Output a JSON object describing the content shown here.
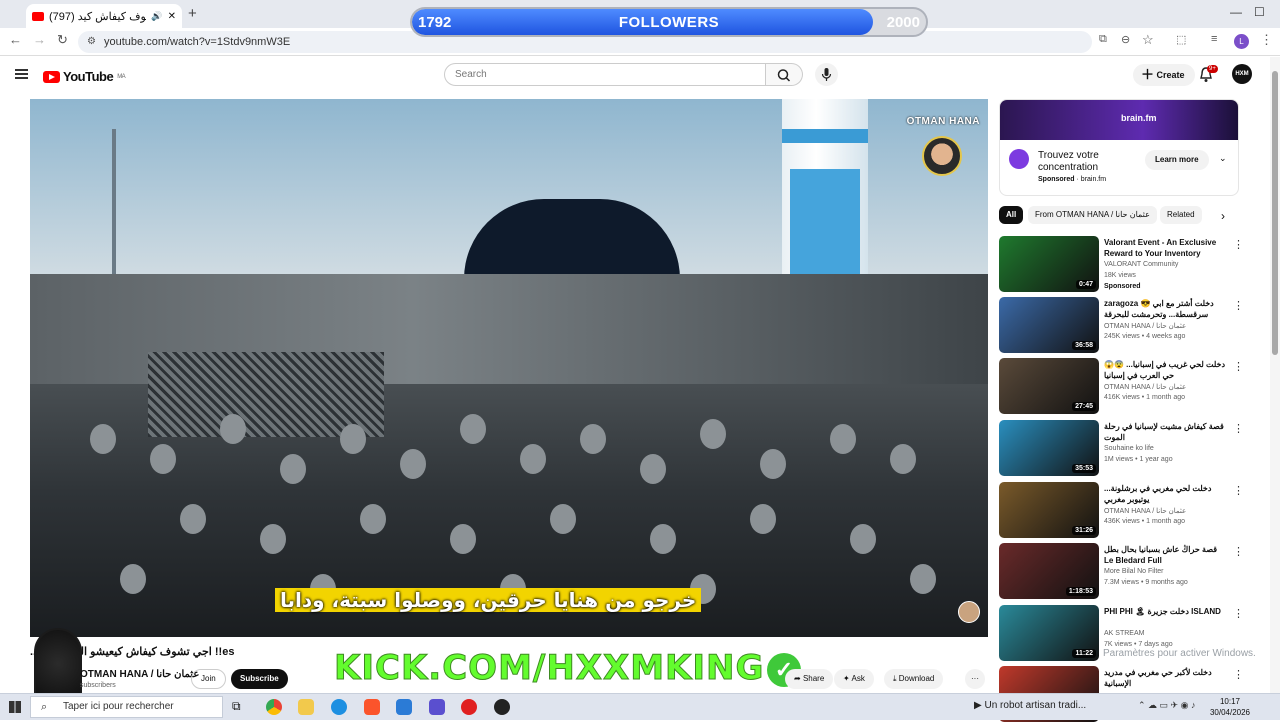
{
  "browser": {
    "tab_title": "(797) اجي تشوف كيفاش كيد",
    "url": "youtube.com/watch?v=1Stdv9nmW3E",
    "new_tab": "+",
    "window_controls": [
      "—",
      "☐",
      "✕"
    ]
  },
  "followers_overlay": {
    "current": "1792",
    "label": "FOLLOWERS",
    "goal": "2000",
    "progress_fraction": 0.896
  },
  "youtube": {
    "logo": "YouTube",
    "region": "MA",
    "search_placeholder": "Search",
    "create_label": "Create",
    "notification_badge": "9+",
    "avatar_text": "HXM"
  },
  "video": {
    "watermark_channel": "OTMAN HANA",
    "subtitle": "خرجو من هنايا حرقين، ووصلوا سبتة، ودابا"
  },
  "below_video": {
    "title": "es!! اجي تشوف كيفاش كيعيشو الحراڭة ال...",
    "channel_name": "OTMAN HANA / عثمان حانا",
    "subscribers": "subscribers",
    "join_label": "Join",
    "subscribe_label": "Subscribe",
    "kick_overlay": "KICK.COM/HXXMKING",
    "share_label": "Share",
    "ask_label": "Ask",
    "download_label": "Download",
    "more_label": "···"
  },
  "ad": {
    "brand": "brain.fm",
    "text": "Trouvez votre concentration",
    "sponsored": "Sponsored",
    "domain": "brain.fm",
    "cta": "Learn more"
  },
  "chips": [
    "All",
    "From OTMAN HANA / عثمان حانا",
    "Related"
  ],
  "recommendations": [
    {
      "title": "Valorant Event - An Exclusive Reward to Your Inventory",
      "channel": "VALORANT Community",
      "meta": "18K views",
      "sponsored": "Sponsored",
      "duration": "0:47",
      "thumb_color": "#1f7a2e"
    },
    {
      "title": "zaragoza 😎 دخلت أشتر مع ابي سرقسطة... وتحرمشت للبحرقة",
      "channel": "OTMAN HANA / عثمان حانا",
      "meta": "245K views • 4 weeks ago",
      "sponsored": "",
      "duration": "36:58",
      "thumb_color": "#3b6aa8"
    },
    {
      "title": "😱😨 دخلت لحي غريب في إسبانيا... حي العرب في إسبانيا",
      "channel": "OTMAN HANA / عثمان حانا",
      "meta": "416K views • 1 month ago",
      "sponsored": "",
      "duration": "27:45",
      "thumb_color": "#5a4a3a"
    },
    {
      "title": "قصة كيفاش مشيت لإسبانيا في رحلة الموت",
      "channel": "Souhaine ko life",
      "meta": "1M views • 1 year ago",
      "sponsored": "",
      "duration": "35:53",
      "thumb_color": "#2a8fbf"
    },
    {
      "title": "دخلت لحي مغربي في برشلونة... يوتيوبر مغربي",
      "channel": "OTMAN HANA / عثمان حانا",
      "meta": "436K views • 1 month ago",
      "sponsored": "",
      "duration": "31:26",
      "thumb_color": "#7a5a2a"
    },
    {
      "title": "قصة حراڭ عاش بسبانيا بحال بطل Le Bledard Full",
      "channel": "More Bilal No Filter",
      "meta": "7.3M views • 9 months ago",
      "sponsored": "",
      "duration": "1:18:53",
      "thumb_color": "#6a2a2a"
    },
    {
      "title": "PHI PHI 🏝 دخلت جزيرة ISLAND",
      "channel": "AK STREAM",
      "meta": "7K views • 7 days ago",
      "sponsored": "",
      "duration": "11:22",
      "thumb_color": "#2a8a9a"
    },
    {
      "title": "دخلت لأكبر حي مغربي في مدريد الإسبانية",
      "channel": "",
      "meta": "",
      "sponsored": "",
      "duration": "",
      "thumb_color": "#c0392b"
    }
  ],
  "activate_windows": "Paramètres pour activer Windows.",
  "taskbar": {
    "search_text": "Taper ici pour rechercher",
    "media_text": "Un robot artisan tradi...",
    "time": "10:17",
    "date": "30/04/2026"
  }
}
